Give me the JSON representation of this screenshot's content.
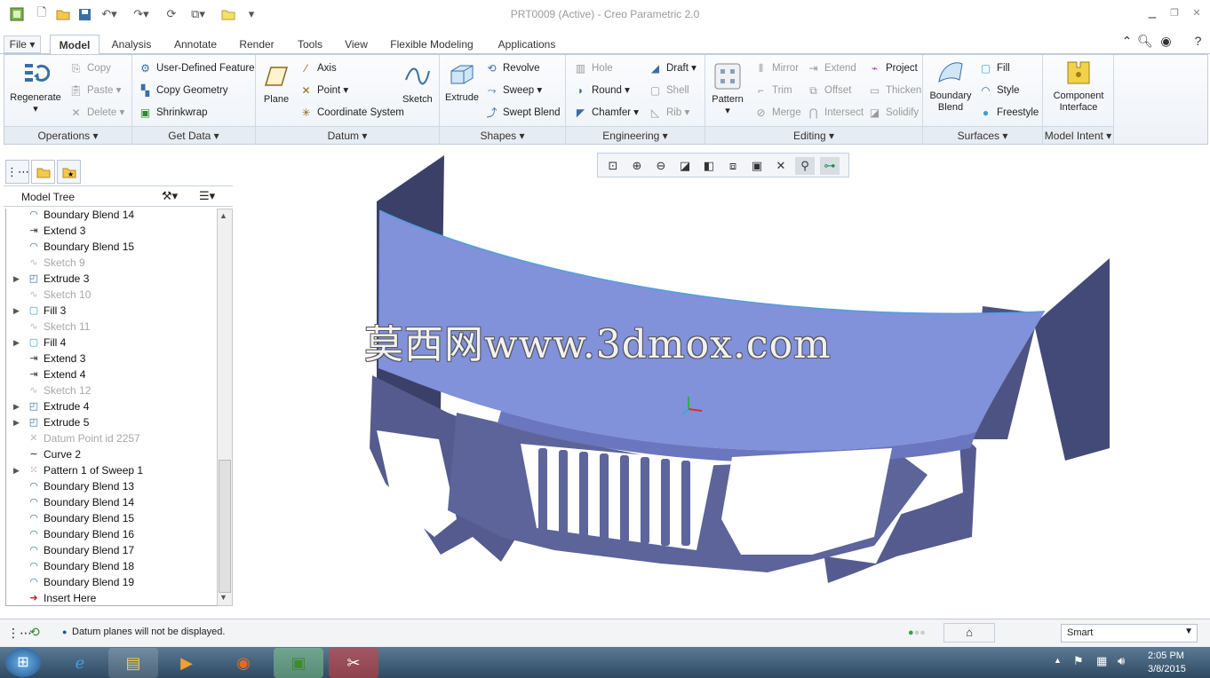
{
  "window": {
    "title": "PRT0009 (Active) - Creo Parametric 2.0"
  },
  "ribbon": {
    "tabs": [
      "File",
      "Model",
      "Analysis",
      "Annotate",
      "Render",
      "Tools",
      "View",
      "Flexible Modeling",
      "Applications"
    ],
    "groups": {
      "operations": {
        "title": "Operations",
        "regenerate": "Regenerate",
        "copy": "Copy",
        "paste": "Paste",
        "delete": "Delete"
      },
      "get_data": {
        "title": "Get Data",
        "udf": "User-Defined Feature",
        "copy_geom": "Copy Geometry",
        "shrinkwrap": "Shrinkwrap"
      },
      "datum": {
        "title": "Datum",
        "plane": "Plane",
        "axis": "Axis",
        "point": "Point",
        "csys": "Coordinate System",
        "sketch": "Sketch"
      },
      "shapes": {
        "title": "Shapes",
        "extrude": "Extrude",
        "revolve": "Revolve",
        "sweep": "Sweep",
        "swept_blend": "Swept Blend"
      },
      "engineering": {
        "title": "Engineering",
        "hole": "Hole",
        "round": "Round",
        "chamfer": "Chamfer",
        "draft": "Draft",
        "shell": "Shell",
        "rib": "Rib"
      },
      "editing": {
        "title": "Editing",
        "pattern": "Pattern",
        "mirror": "Mirror",
        "trim": "Trim",
        "merge": "Merge",
        "extend": "Extend",
        "offset": "Offset",
        "intersect": "Intersect",
        "project": "Project",
        "thicken": "Thicken",
        "solidify": "Solidify"
      },
      "surfaces": {
        "title": "Surfaces",
        "boundary_blend": "Boundary Blend",
        "fill": "Fill",
        "style": "Style",
        "freestyle": "Freestyle"
      },
      "model_intent": {
        "title": "Model Intent",
        "component_interface": "Component Interface"
      }
    }
  },
  "model_tree": {
    "title": "Model Tree",
    "items": [
      {
        "label": "Boundary Blend 14",
        "icon": "boundary-blend-icon",
        "expandable": false,
        "suppressed": false
      },
      {
        "label": "Extend 3",
        "icon": "extend-icon",
        "expandable": false,
        "suppressed": false
      },
      {
        "label": "Boundary Blend 15",
        "icon": "boundary-blend-icon",
        "expandable": false,
        "suppressed": false
      },
      {
        "label": "Sketch 9",
        "icon": "sketch-icon",
        "expandable": false,
        "suppressed": true
      },
      {
        "label": "Extrude 3",
        "icon": "extrude-icon",
        "expandable": true,
        "suppressed": false
      },
      {
        "label": "Sketch 10",
        "icon": "sketch-icon",
        "expandable": false,
        "suppressed": true
      },
      {
        "label": "Fill 3",
        "icon": "fill-icon",
        "expandable": true,
        "suppressed": false
      },
      {
        "label": "Sketch 11",
        "icon": "sketch-icon",
        "expandable": false,
        "suppressed": true
      },
      {
        "label": "Fill 4",
        "icon": "fill-icon",
        "expandable": true,
        "suppressed": false
      },
      {
        "label": "Extend 3",
        "icon": "extend-icon",
        "expandable": false,
        "suppressed": false
      },
      {
        "label": "Extend 4",
        "icon": "extend-icon",
        "expandable": false,
        "suppressed": false
      },
      {
        "label": "Sketch 12",
        "icon": "sketch-icon",
        "expandable": false,
        "suppressed": true
      },
      {
        "label": "Extrude 4",
        "icon": "extrude-icon",
        "expandable": true,
        "suppressed": false
      },
      {
        "label": "Extrude 5",
        "icon": "extrude-icon",
        "expandable": true,
        "suppressed": false
      },
      {
        "label": "Datum Point id 2257",
        "icon": "datum-point-icon",
        "expandable": false,
        "suppressed": true
      },
      {
        "label": "Curve 2",
        "icon": "curve-icon",
        "expandable": false,
        "suppressed": false
      },
      {
        "label": "Pattern 1 of Sweep 1",
        "icon": "pattern-icon",
        "expandable": true,
        "suppressed": false
      },
      {
        "label": "Boundary Blend 13",
        "icon": "boundary-blend-icon",
        "expandable": false,
        "suppressed": false
      },
      {
        "label": "Boundary Blend 14",
        "icon": "boundary-blend-icon",
        "expandable": false,
        "suppressed": false
      },
      {
        "label": "Boundary Blend 15",
        "icon": "boundary-blend-icon",
        "expandable": false,
        "suppressed": false
      },
      {
        "label": "Boundary Blend 16",
        "icon": "boundary-blend-icon",
        "expandable": false,
        "suppressed": false
      },
      {
        "label": "Boundary Blend 17",
        "icon": "boundary-blend-icon",
        "expandable": false,
        "suppressed": false
      },
      {
        "label": "Boundary Blend 18",
        "icon": "boundary-blend-icon",
        "expandable": false,
        "suppressed": false
      },
      {
        "label": "Boundary Blend 19",
        "icon": "boundary-blend-icon",
        "expandable": false,
        "suppressed": false
      },
      {
        "label": "Insert Here",
        "icon": "insert-here-arrow-icon",
        "expandable": false,
        "suppressed": false
      }
    ]
  },
  "viewport": {
    "watermark": "莫西网www.3dmox.com",
    "model_color": "#7f8fd8",
    "background": "#ffffff"
  },
  "status_bar": {
    "message": "Datum planes will not be displayed.",
    "filter": "Smart"
  },
  "taskbar": {
    "time": "2:05 PM",
    "date": "3/8/2015"
  },
  "colors": {
    "accent": "#3a6ea5",
    "model_top": "#8494dc",
    "model_side": "#4a507a"
  }
}
